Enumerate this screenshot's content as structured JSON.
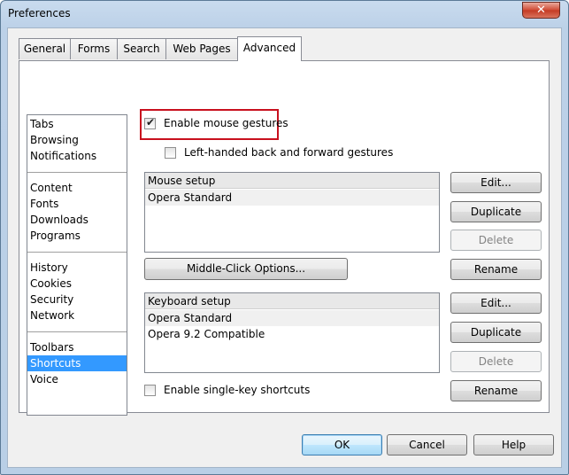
{
  "window": {
    "title": "Preferences",
    "close_glyph": "✕"
  },
  "tabs": [
    {
      "label": "General",
      "active": false
    },
    {
      "label": "Forms",
      "active": false
    },
    {
      "label": "Search",
      "active": false
    },
    {
      "label": "Web Pages",
      "active": false
    },
    {
      "label": "Advanced",
      "active": true
    }
  ],
  "sidebar": {
    "groups": [
      [
        "Tabs",
        "Browsing",
        "Notifications"
      ],
      [
        "Content",
        "Fonts",
        "Downloads",
        "Programs"
      ],
      [
        "History",
        "Cookies",
        "Security",
        "Network"
      ],
      [
        "Toolbars",
        "Shortcuts",
        "Voice"
      ]
    ],
    "selected": "Shortcuts"
  },
  "shortcuts": {
    "enable_mouse_gestures": {
      "label": "Enable mouse gestures",
      "checked": true
    },
    "left_handed": {
      "label": "Left-handed back and forward gestures",
      "checked": false
    },
    "mouse_setup": {
      "header": "Mouse setup",
      "items": [
        "Opera Standard"
      ]
    },
    "middle_click_label": "Middle-Click Options...",
    "keyboard_setup": {
      "header": "Keyboard setup",
      "items": [
        "Opera Standard",
        "Opera 9.2 Compatible"
      ]
    },
    "single_key": {
      "label": "Enable single-key shortcuts",
      "checked": false
    },
    "buttons": {
      "edit": "Edit...",
      "duplicate": "Duplicate",
      "delete": "Delete",
      "rename": "Rename"
    }
  },
  "footer": {
    "ok": "OK",
    "cancel": "Cancel",
    "help": "Help"
  }
}
